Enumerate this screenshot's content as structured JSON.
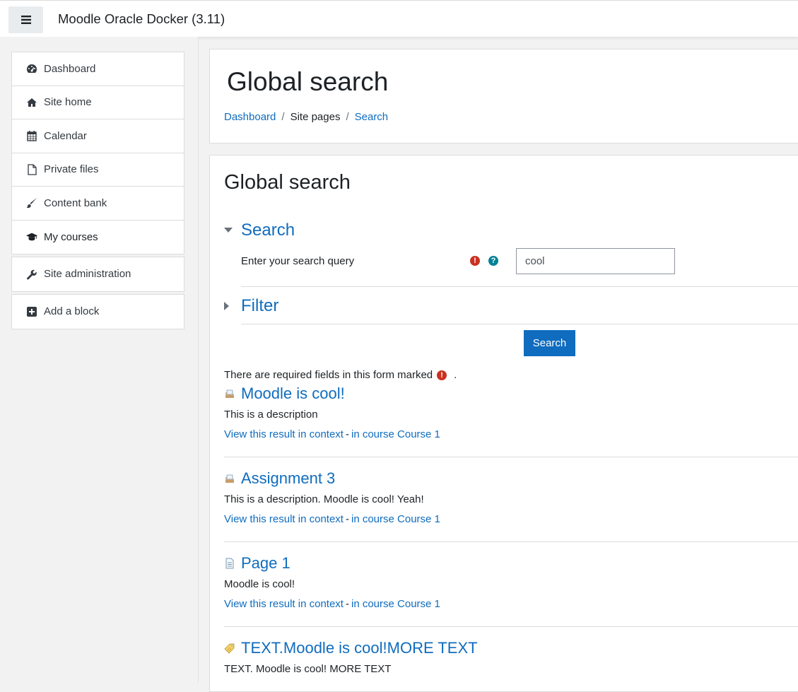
{
  "navbar": {
    "toggle_icon": "hamburger-icon",
    "site_name": "Moodle Oracle Docker (3.11)"
  },
  "drawer": {
    "groups": [
      [
        {
          "label": "Dashboard",
          "icon": "dashboard-icon"
        },
        {
          "label": "Site home",
          "icon": "home-icon"
        },
        {
          "label": "Calendar",
          "icon": "calendar-icon"
        },
        {
          "label": "Private files",
          "icon": "file-icon"
        },
        {
          "label": "Content bank",
          "icon": "paintbrush-icon"
        },
        {
          "label": "My courses",
          "icon": "graduation-cap-icon"
        }
      ],
      [
        {
          "label": "Site administration",
          "icon": "wrench-icon"
        }
      ],
      [
        {
          "label": "Add a block",
          "icon": "plus-square-icon"
        }
      ]
    ]
  },
  "header": {
    "title": "Global search",
    "breadcrumb": [
      "Dashboard",
      "Site pages",
      "Search"
    ]
  },
  "main": {
    "heading": "Global search",
    "search_section": {
      "legend": "Search",
      "field_label": "Enter your search query",
      "query_value": "cool"
    },
    "filter_section": {
      "legend": "Filter"
    },
    "search_button": "Search",
    "required_note_prefix": "There are required fields in this form marked",
    "required_note_suffix": ".",
    "results": [
      {
        "title": "Moodle is cool!",
        "icon": "assignment-icon",
        "description": "This is a description",
        "context_link": "View this result in context",
        "separator": "-",
        "course_link": "in course Course 1"
      },
      {
        "title": "Assignment 3",
        "icon": "assignment-icon",
        "description": "This is a description. Moodle is cool! Yeah!",
        "context_link": "View this result in context",
        "separator": "-",
        "course_link": "in course Course 1"
      },
      {
        "title": "Page 1",
        "icon": "page-icon",
        "description": "Moodle is cool!",
        "context_link": "View this result in context",
        "separator": "-",
        "course_link": "in course Course 1"
      },
      {
        "title": "TEXT.Moodle is cool!MORE TEXT",
        "icon": "label-icon",
        "description": "TEXT. Moodle is cool! MORE TEXT"
      }
    ]
  },
  "colors": {
    "link": "#0f6cbf",
    "required": "#ca3120",
    "help": "#008196"
  }
}
